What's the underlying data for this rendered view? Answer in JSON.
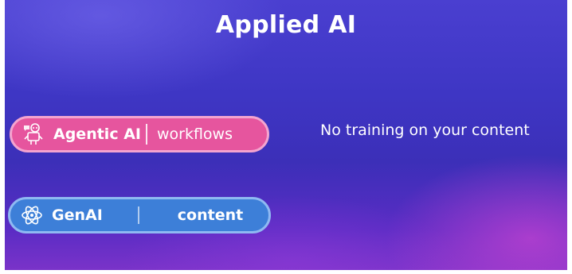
{
  "slide": {
    "title": "Applied AI",
    "note": "No training on your content"
  },
  "pills": [
    {
      "label": "Agentic AI",
      "sub": "workflows",
      "icon": "robot-icon",
      "color": "#e6559e"
    },
    {
      "label": "GenAI",
      "sub": "content",
      "icon": "atom-icon",
      "color": "#3d7fd8"
    }
  ]
}
